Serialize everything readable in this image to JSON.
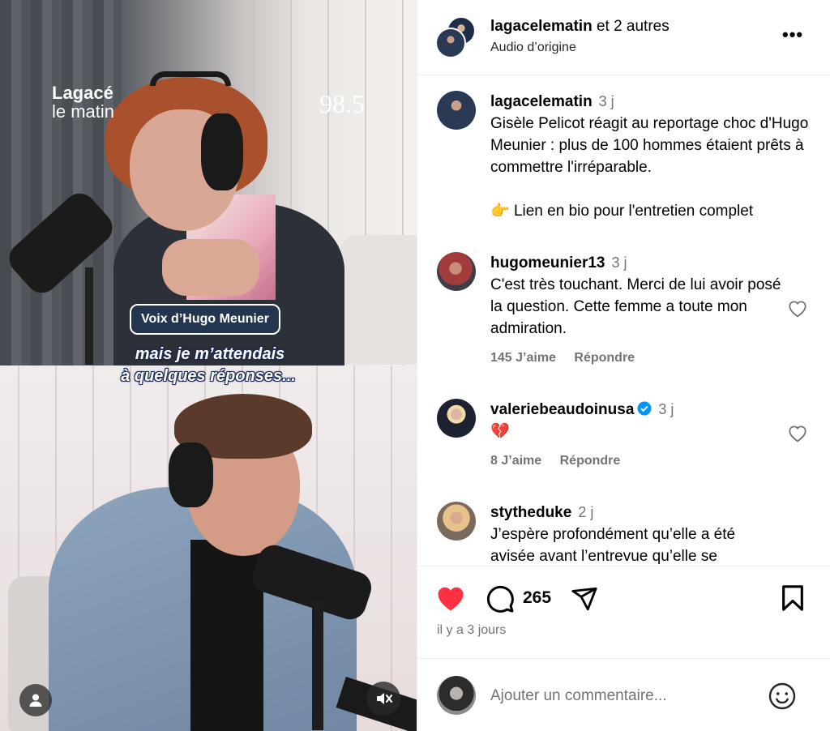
{
  "video": {
    "brand_line1": "Lagacé",
    "brand_line2": "le matin",
    "station": "98.5",
    "badge": "Voix d’Hugo Meunier",
    "subtitle_line1": "mais je m’attendais",
    "subtitle_line2": "à quelques réponses...",
    "user_icon": "user-icon",
    "mute_icon": "muted-speaker-icon"
  },
  "header": {
    "author": "lagacelematin",
    "coauthors": " et 2 autres",
    "audio": "Audio d’origine",
    "more": "•••"
  },
  "caption": {
    "user": "lagacelematin",
    "time": "3 j",
    "text": "Gisèle Pelicot réagit au reportage choc d'Hugo Meunier : plus de 100 hommes étaient prêts à commettre l'irréparable.",
    "link_emoji": "👉",
    "link_text": " Lien en bio pour l'entretien complet"
  },
  "comments": [
    {
      "user": "hugomeunier13",
      "time": "3 j",
      "text": "C'est très touchant. Merci de lui avoir posé la question. Cette femme a toute mon admiration.",
      "likes": "145 J’aime",
      "reply": "Répondre"
    },
    {
      "user": "valeriebeaudoinusa",
      "time": "3 j",
      "text": "💔",
      "likes": "8 J’aime",
      "reply": "Répondre"
    },
    {
      "user": "stytheduke",
      "time": "2 j",
      "text": "J’espère profondément qu’elle a été avisée avant l’entrevue qu’elle se"
    }
  ],
  "actions": {
    "comment_count": "265",
    "posted": "il y a 3 jours",
    "like_color": "#ff3040"
  },
  "add_comment": {
    "placeholder": "Ajouter un commentaire..."
  }
}
